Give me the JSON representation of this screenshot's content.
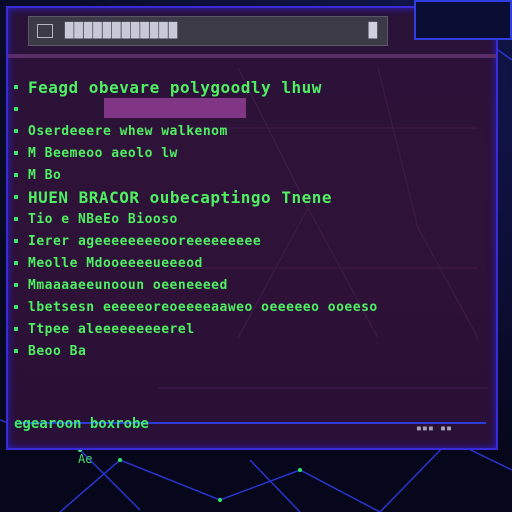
{
  "window": {
    "title": "████████████",
    "close_icon": "█"
  },
  "lines": [
    {
      "text": "Feagd obevare polygoodly  lhuw",
      "big": true
    },
    {
      "text": "",
      "bar": true
    },
    {
      "text": "Oserdeeere whew walkenom"
    },
    {
      "text": "M Beemeoo aeolo lw"
    },
    {
      "text": "M Bo"
    },
    {
      "text": "HUEN BRACOR oubecaptingo  Tnene",
      "big": true
    },
    {
      "text": "Tio e NBeEo Biooso"
    },
    {
      "text": "Ierer ageeeeeeeeooreeeeeeeee"
    },
    {
      "text": "Meolle Mdooeeeeueeeod"
    },
    {
      "text": "Mmaaaaeeunooun oeeneeeed"
    },
    {
      "text": "lbetsesn eeeeeoreoeeeeaaweo oeeeeeo ooeeso"
    },
    {
      "text": "Ttpee aleeeeeeeeerel"
    },
    {
      "text": "Beoo Ba"
    }
  ],
  "footer": {
    "left": "egearoon boxrobe",
    "right": "▪▪▪ ▪▪"
  },
  "below_text": "Ae"
}
